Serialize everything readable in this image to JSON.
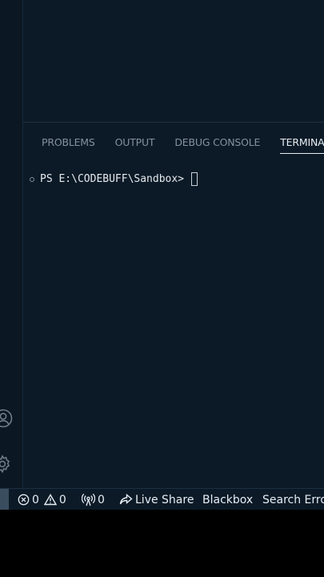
{
  "panel": {
    "tabs": [
      {
        "label": "PROBLEMS",
        "active": false
      },
      {
        "label": "OUTPUT",
        "active": false
      },
      {
        "label": "DEBUG CONSOLE",
        "active": false
      },
      {
        "label": "TERMINAL",
        "active": true
      }
    ]
  },
  "terminal": {
    "prompt": "PS E:\\CODEBUFF\\Sandbox>"
  },
  "status_bar": {
    "errors": "0",
    "warnings": "0",
    "ports": "0",
    "live_share": "Live Share",
    "blackbox": "Blackbox",
    "search_error": "Search Error"
  },
  "icons": [
    "account-icon",
    "gear-icon",
    "error-icon",
    "warning-icon",
    "broadcast-icon",
    "live-share-icon"
  ],
  "colors": {
    "background": "#0c1a27",
    "text": "#e6edf3",
    "muted": "#8391a0"
  }
}
